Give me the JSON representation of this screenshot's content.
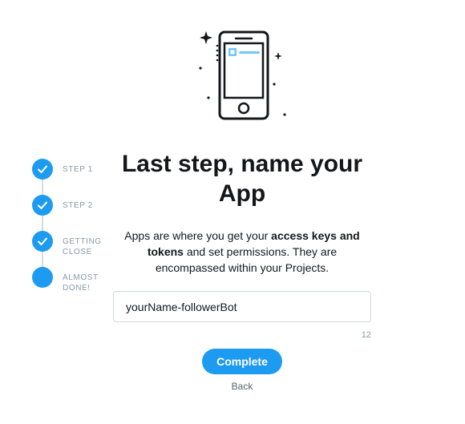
{
  "steps": [
    {
      "label": "Step 1",
      "state": "done"
    },
    {
      "label": "Step 2",
      "state": "done"
    },
    {
      "label": "Getting close",
      "state": "done"
    },
    {
      "label": "Almost done!",
      "state": "current"
    }
  ],
  "title": "Last step, name your App",
  "description": {
    "part1": "Apps are where you get your ",
    "bold1": "access keys and tokens",
    "part2": " and set permissions. They are encompassed within your Projects."
  },
  "app_name": {
    "value": "yourName-followerBot",
    "char_count": "12"
  },
  "actions": {
    "complete_label": "Complete",
    "back_label": "Back"
  },
  "colors": {
    "accent": "#1d9bf0",
    "muted": "#8899a6",
    "line": "#d3dde4"
  }
}
